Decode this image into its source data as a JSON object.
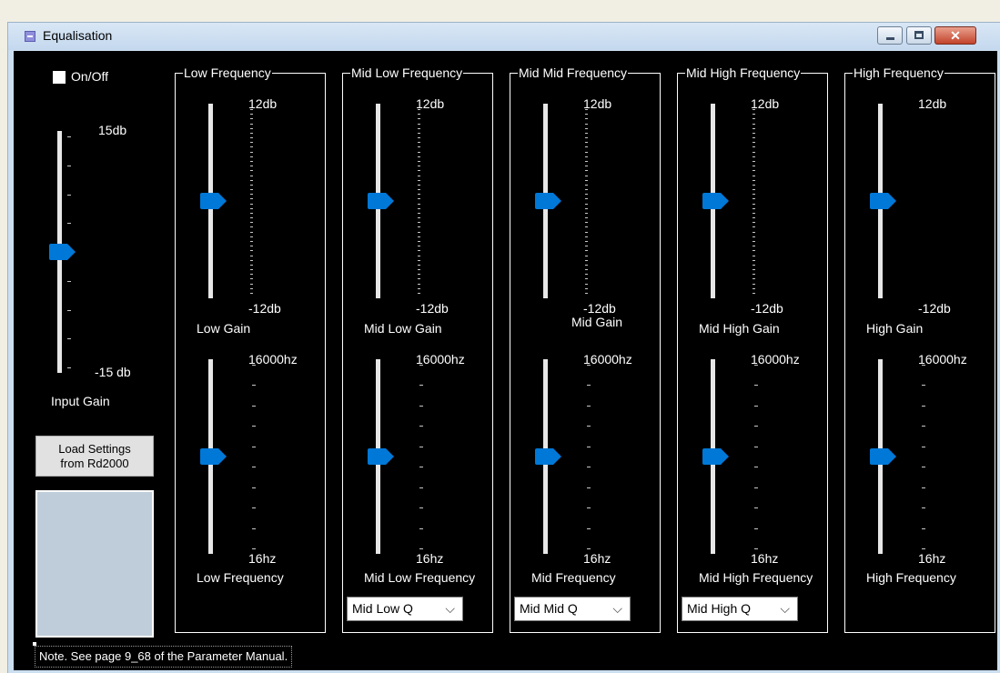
{
  "window": {
    "title": "Equalisation",
    "controls": {
      "minimize": "minimize",
      "maximize": "maximize",
      "close": "✕"
    }
  },
  "colors": {
    "accent": "#0078d7",
    "background": "#000000"
  },
  "master": {
    "onoff_label": "On/Off",
    "onoff_checked": false,
    "input_gain": {
      "top_label": "15db",
      "bottom_label": "-15 db",
      "caption": "Input Gain",
      "value_fraction": 0.5
    },
    "load_button_line1": "Load Settings",
    "load_button_line2": "from Rd2000"
  },
  "bands": [
    {
      "legend": "Low Frequency",
      "gain": {
        "top": "12db",
        "bottom": "-12db",
        "caption": "Low Gain",
        "value_fraction": 0.5
      },
      "freq": {
        "top": "16000hz",
        "bottom": "16hz",
        "caption": "Low Frequency",
        "value_fraction": 0.5
      },
      "q": null
    },
    {
      "legend": "Mid Low Frequency",
      "gain": {
        "top": "12db",
        "bottom": "-12db",
        "caption": "Mid Low Gain",
        "value_fraction": 0.5
      },
      "freq": {
        "top": "16000hz",
        "bottom": "16hz",
        "caption": "Mid Low Frequency",
        "value_fraction": 0.5
      },
      "q": "Mid Low Q"
    },
    {
      "legend": "Mid Mid Frequency",
      "gain": {
        "top": "12db",
        "bottom": "-12db",
        "caption": "Mid Gain",
        "value_fraction": 0.5
      },
      "freq": {
        "top": "16000hz",
        "bottom": "16hz",
        "caption": "Mid Frequency",
        "value_fraction": 0.5
      },
      "q": "Mid Mid Q"
    },
    {
      "legend": "Mid High Frequency",
      "gain": {
        "top": "12db",
        "bottom": "-12db",
        "caption": "Mid High  Gain",
        "value_fraction": 0.5
      },
      "freq": {
        "top": "16000hz",
        "bottom": "16hz",
        "caption": "Mid High Frequency",
        "value_fraction": 0.5
      },
      "q": "Mid High Q"
    },
    {
      "legend": "High Frequency",
      "gain": {
        "top": "12db",
        "bottom": "-12db",
        "caption": "High Gain",
        "value_fraction": 0.5
      },
      "freq": {
        "top": "16000hz",
        "bottom": "16hz",
        "caption": "High Frequency",
        "value_fraction": 0.5
      },
      "q": null
    }
  ],
  "note": "Note. See page 9_68 of the Parameter Manual.",
  "icons": {
    "combo_arrow": "chevron-down-icon",
    "slider_thumb": "slider-thumb-icon"
  }
}
